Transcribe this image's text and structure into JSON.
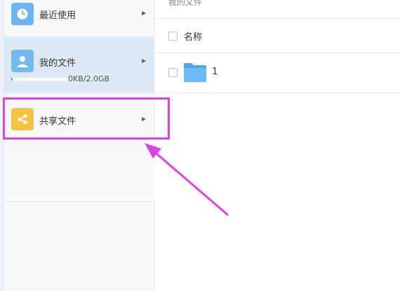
{
  "sidebar": {
    "recent": {
      "label": "最近使用",
      "icon": "clock-icon"
    },
    "my_files": {
      "label": "我的文件",
      "icon": "user-icon",
      "quota_text": "0KB/2.0GB",
      "quota_fraction": 0.0
    },
    "shared": {
      "label": "共享文件",
      "icon": "share-icon"
    }
  },
  "main": {
    "breadcrumb": "我的文件",
    "column_name": "名称",
    "files": [
      {
        "name": "1",
        "type": "folder",
        "icon": "folder-icon"
      }
    ]
  },
  "annotation": {
    "color": "#e040e8"
  },
  "colors": {
    "accent": "#4a9de0",
    "selected_bg": "#dceaf6",
    "share_icon_bg": "#f5c343",
    "folder": "#5bb3f2"
  }
}
